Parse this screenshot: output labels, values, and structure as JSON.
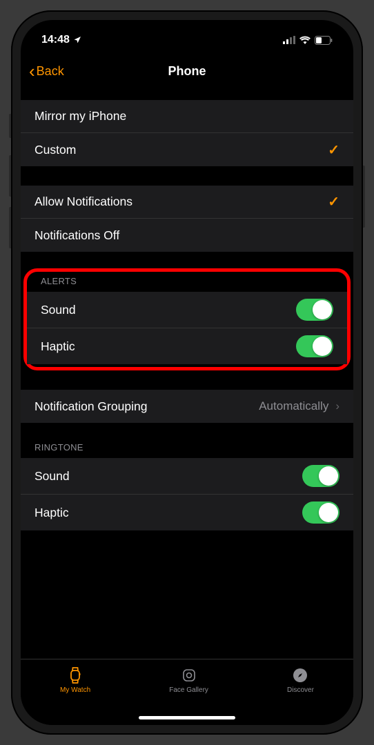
{
  "status": {
    "time": "14:48",
    "location_icon": "location-arrow"
  },
  "nav": {
    "back_label": "Back",
    "title": "Phone"
  },
  "section_mirror": {
    "items": [
      {
        "label": "Mirror my iPhone",
        "checked": false
      },
      {
        "label": "Custom",
        "checked": true
      }
    ]
  },
  "section_notifications": {
    "items": [
      {
        "label": "Allow Notifications",
        "checked": true
      },
      {
        "label": "Notifications Off",
        "checked": false
      }
    ]
  },
  "section_alerts": {
    "header": "ALERTS",
    "items": [
      {
        "label": "Sound",
        "on": true
      },
      {
        "label": "Haptic",
        "on": true
      }
    ]
  },
  "section_grouping": {
    "items": [
      {
        "label": "Notification Grouping",
        "value": "Automatically"
      }
    ]
  },
  "section_ringtone": {
    "header": "RINGTONE",
    "items": [
      {
        "label": "Sound",
        "on": true
      },
      {
        "label": "Haptic",
        "on": true
      }
    ]
  },
  "tabs": {
    "items": [
      {
        "label": "My Watch",
        "active": true,
        "icon": "watch"
      },
      {
        "label": "Face Gallery",
        "active": false,
        "icon": "face"
      },
      {
        "label": "Discover",
        "active": false,
        "icon": "compass"
      }
    ]
  }
}
